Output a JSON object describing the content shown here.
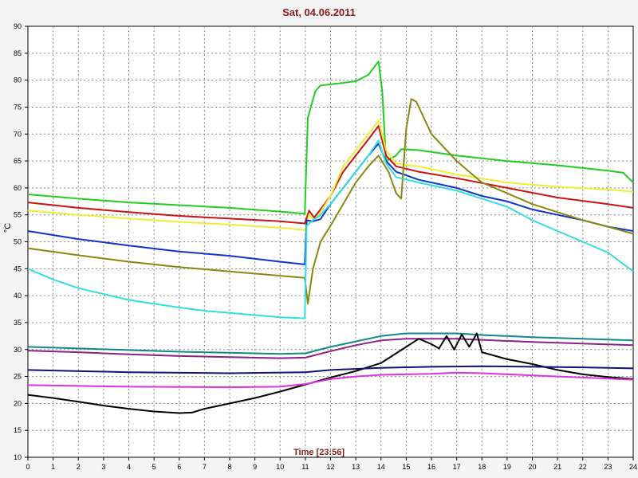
{
  "chart_data": {
    "type": "line",
    "title": "Sat, 04.06.2011",
    "xlabel": "Time [23:56]",
    "ylabel": "°C",
    "xlim": [
      0,
      24
    ],
    "ylim": [
      10,
      90
    ],
    "x_ticks": [
      0,
      1,
      2,
      3,
      4,
      5,
      6,
      7,
      8,
      9,
      10,
      11,
      12,
      13,
      14,
      15,
      16,
      17,
      18,
      19,
      20,
      21,
      22,
      23,
      24
    ],
    "y_ticks": [
      10,
      15,
      20,
      25,
      30,
      35,
      40,
      45,
      50,
      55,
      60,
      65,
      70,
      75,
      80,
      85,
      90
    ],
    "grid": true,
    "series": [
      {
        "color": "#22cc22",
        "points": [
          [
            0,
            58.8
          ],
          [
            2,
            58
          ],
          [
            4,
            57.3
          ],
          [
            6,
            56.8
          ],
          [
            8,
            56.3
          ],
          [
            10,
            55.6
          ],
          [
            10.98,
            55.2
          ],
          [
            11.1,
            73
          ],
          [
            11.4,
            78
          ],
          [
            11.6,
            79
          ],
          [
            12.5,
            79.5
          ],
          [
            13,
            79.8
          ],
          [
            13.5,
            81
          ],
          [
            13.9,
            83.5
          ],
          [
            14.05,
            78
          ],
          [
            14.2,
            65
          ],
          [
            14.6,
            66
          ],
          [
            14.8,
            67.2
          ],
          [
            15.5,
            67
          ],
          [
            17,
            66
          ],
          [
            19,
            65
          ],
          [
            21,
            64.2
          ],
          [
            23,
            63.2
          ],
          [
            23.6,
            62.8
          ],
          [
            24,
            61
          ]
        ]
      },
      {
        "color": "#cc1111",
        "points": [
          [
            0,
            57.3
          ],
          [
            2,
            56.3
          ],
          [
            4,
            55.5
          ],
          [
            6,
            54.8
          ],
          [
            8,
            54.3
          ],
          [
            10,
            53.8
          ],
          [
            10.98,
            53.4
          ],
          [
            11.15,
            55.8
          ],
          [
            11.35,
            54.5
          ],
          [
            11.6,
            56
          ],
          [
            12,
            58.5
          ],
          [
            12.5,
            63
          ],
          [
            13,
            66
          ],
          [
            13.5,
            69
          ],
          [
            13.9,
            71.5
          ],
          [
            14.2,
            66
          ],
          [
            14.6,
            64
          ],
          [
            15.5,
            63
          ],
          [
            17,
            61.8
          ],
          [
            19,
            60
          ],
          [
            21,
            58.2
          ],
          [
            23,
            57
          ],
          [
            24,
            56.3
          ]
        ]
      },
      {
        "color": "#eeee33",
        "points": [
          [
            0,
            55.8
          ],
          [
            2,
            55
          ],
          [
            4,
            54.3
          ],
          [
            6,
            53.7
          ],
          [
            8,
            53.2
          ],
          [
            10,
            52.6
          ],
          [
            10.98,
            52.2
          ],
          [
            11.15,
            55
          ],
          [
            11.35,
            54
          ],
          [
            11.6,
            55.5
          ],
          [
            12,
            58.5
          ],
          [
            12.5,
            64
          ],
          [
            13,
            67
          ],
          [
            13.5,
            70
          ],
          [
            13.9,
            72.5
          ],
          [
            14.2,
            67
          ],
          [
            14.6,
            64.5
          ],
          [
            15.5,
            64
          ],
          [
            17,
            62.5
          ],
          [
            19,
            61
          ],
          [
            21,
            60.2
          ],
          [
            23,
            59.7
          ],
          [
            24,
            59.3
          ]
        ]
      },
      {
        "color": "#1133cc",
        "points": [
          [
            0,
            52
          ],
          [
            2,
            50.5
          ],
          [
            4,
            49.3
          ],
          [
            6,
            48.2
          ],
          [
            8,
            47.4
          ],
          [
            10,
            46.3
          ],
          [
            10.98,
            45.8
          ],
          [
            11.05,
            54
          ],
          [
            11.3,
            53.8
          ],
          [
            11.6,
            54.2
          ],
          [
            12,
            57
          ],
          [
            12.5,
            60
          ],
          [
            13,
            63
          ],
          [
            13.5,
            66
          ],
          [
            13.9,
            68.2
          ],
          [
            14.2,
            65
          ],
          [
            14.6,
            63
          ],
          [
            15.5,
            61.5
          ],
          [
            17,
            60
          ],
          [
            18,
            58.5
          ],
          [
            19,
            57.5
          ],
          [
            20,
            56
          ],
          [
            21,
            55
          ],
          [
            22,
            54
          ],
          [
            23,
            52.8
          ],
          [
            24,
            52
          ]
        ]
      },
      {
        "color": "#888811",
        "points": [
          [
            0,
            48.8
          ],
          [
            2,
            47.5
          ],
          [
            4,
            46.3
          ],
          [
            6,
            45.3
          ],
          [
            8,
            44.5
          ],
          [
            10,
            43.7
          ],
          [
            10.98,
            43.3
          ],
          [
            11.1,
            38.5
          ],
          [
            11.3,
            45
          ],
          [
            11.6,
            50
          ],
          [
            12,
            53
          ],
          [
            12.5,
            57
          ],
          [
            13,
            61
          ],
          [
            13.5,
            64
          ],
          [
            13.9,
            66
          ],
          [
            14.3,
            63
          ],
          [
            14.6,
            59
          ],
          [
            14.8,
            58
          ],
          [
            15,
            71
          ],
          [
            15.2,
            76.5
          ],
          [
            15.4,
            76
          ],
          [
            16,
            70
          ],
          [
            17,
            65
          ],
          [
            18,
            61
          ],
          [
            19,
            59
          ],
          [
            20,
            57
          ],
          [
            21,
            55.5
          ],
          [
            22,
            54
          ],
          [
            23,
            52.8
          ],
          [
            24,
            51.5
          ]
        ]
      },
      {
        "color": "#33dddd",
        "points": [
          [
            0,
            45
          ],
          [
            1,
            43
          ],
          [
            2,
            41.4
          ],
          [
            3,
            40.3
          ],
          [
            4,
            39.2
          ],
          [
            5,
            38.5
          ],
          [
            6,
            37.8
          ],
          [
            7,
            37.2
          ],
          [
            8,
            36.8
          ],
          [
            9,
            36.4
          ],
          [
            10,
            36
          ],
          [
            10.98,
            35.8
          ],
          [
            11.05,
            53
          ],
          [
            11.3,
            54
          ],
          [
            11.6,
            55
          ],
          [
            12,
            57
          ],
          [
            12.5,
            60
          ],
          [
            13,
            63
          ],
          [
            13.5,
            66
          ],
          [
            13.9,
            68.8
          ],
          [
            14.2,
            64.5
          ],
          [
            14.6,
            62
          ],
          [
            15.5,
            61
          ],
          [
            17,
            59.5
          ],
          [
            18,
            58
          ],
          [
            19,
            56.5
          ],
          [
            20,
            54
          ],
          [
            21,
            52
          ],
          [
            22,
            50
          ],
          [
            23,
            48
          ],
          [
            24,
            44.5
          ]
        ]
      },
      {
        "color": "#118888",
        "points": [
          [
            0,
            30.5
          ],
          [
            2,
            30.2
          ],
          [
            4,
            29.9
          ],
          [
            6,
            29.6
          ],
          [
            8,
            29.4
          ],
          [
            10,
            29.2
          ],
          [
            11,
            29.3
          ],
          [
            12,
            30.5
          ],
          [
            13,
            31.5
          ],
          [
            14,
            32.5
          ],
          [
            15,
            33
          ],
          [
            16,
            33
          ],
          [
            17,
            33
          ],
          [
            18,
            32.7
          ],
          [
            20,
            32.3
          ],
          [
            22,
            32
          ],
          [
            24,
            31.7
          ]
        ]
      },
      {
        "color": "#882288",
        "points": [
          [
            0,
            29.8
          ],
          [
            2,
            29.5
          ],
          [
            4,
            29.1
          ],
          [
            6,
            28.8
          ],
          [
            8,
            28.6
          ],
          [
            10,
            28.4
          ],
          [
            11,
            28.5
          ],
          [
            12,
            29.7
          ],
          [
            13,
            30.8
          ],
          [
            14,
            31.7
          ],
          [
            15,
            32
          ],
          [
            16,
            32
          ],
          [
            17,
            32
          ],
          [
            18,
            31.8
          ],
          [
            20,
            31.4
          ],
          [
            22,
            31.1
          ],
          [
            24,
            30.8
          ]
        ]
      },
      {
        "color": "#000000",
        "points": [
          [
            0,
            21.6
          ],
          [
            1,
            21
          ],
          [
            2,
            20.3
          ],
          [
            3,
            19.6
          ],
          [
            4,
            19
          ],
          [
            5,
            18.5
          ],
          [
            6,
            18.2
          ],
          [
            6.5,
            18.3
          ],
          [
            7,
            19
          ],
          [
            8,
            20
          ],
          [
            9,
            21
          ],
          [
            10,
            22.2
          ],
          [
            11,
            23.5
          ],
          [
            12,
            24.8
          ],
          [
            13,
            26
          ],
          [
            14,
            27.5
          ],
          [
            14.5,
            29
          ],
          [
            15,
            30.5
          ],
          [
            15.5,
            32
          ],
          [
            16,
            31
          ],
          [
            16.3,
            30.2
          ],
          [
            16.6,
            32.5
          ],
          [
            16.9,
            30
          ],
          [
            17.2,
            32.8
          ],
          [
            17.5,
            30.5
          ],
          [
            17.8,
            33
          ],
          [
            18,
            29.5
          ],
          [
            19,
            28.2
          ],
          [
            20,
            27.3
          ],
          [
            21,
            26.2
          ],
          [
            22,
            25.4
          ],
          [
            23,
            24.9
          ],
          [
            24,
            24.5
          ]
        ]
      },
      {
        "color": "#111177",
        "points": [
          [
            0,
            26.2
          ],
          [
            4,
            25.8
          ],
          [
            8,
            25.6
          ],
          [
            11,
            25.8
          ],
          [
            12,
            26.2
          ],
          [
            14,
            26.6
          ],
          [
            16,
            26.8
          ],
          [
            18,
            26.9
          ],
          [
            20,
            26.8
          ],
          [
            22,
            26.7
          ],
          [
            24,
            26.5
          ]
        ]
      },
      {
        "color": "#dd33dd",
        "points": [
          [
            0,
            23.4
          ],
          [
            4,
            23.1
          ],
          [
            8,
            23
          ],
          [
            10,
            23.1
          ],
          [
            11,
            23.6
          ],
          [
            12,
            24.5
          ],
          [
            13,
            25
          ],
          [
            14,
            25.3
          ],
          [
            15,
            25.4
          ],
          [
            16,
            25.5
          ],
          [
            17,
            25.7
          ],
          [
            18,
            25.6
          ],
          [
            20,
            25.2
          ],
          [
            22,
            24.8
          ],
          [
            24,
            24.4
          ]
        ]
      }
    ]
  }
}
